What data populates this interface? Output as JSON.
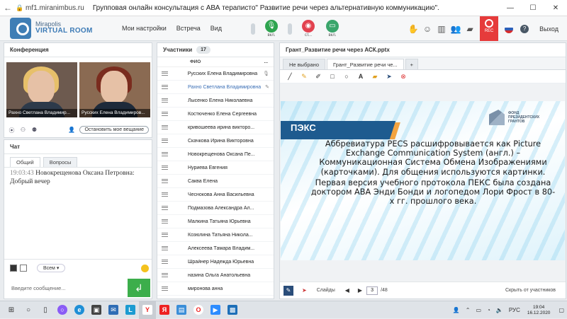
{
  "browser": {
    "back_icon": "back-arrow-icon",
    "url": "mf1.miranimbus.ru",
    "title": "Групповая онлайн консультация с АВА тераписто\" Развитие речи через альтернативную коммуникацию\".",
    "window_controls": [
      "—",
      "☐",
      "✕"
    ]
  },
  "app": {
    "logo_line1": "Mirapolis",
    "logo_line2": "VIRTUAL ROOM",
    "menu": [
      "Мои настройки",
      "Встреча",
      "Вид"
    ],
    "controls": [
      {
        "label": "вкл.",
        "icon": "microphone-icon",
        "color": "#2ea44f"
      },
      {
        "label": "ст...",
        "icon": "camera-icon",
        "color": "#e2424f"
      },
      {
        "label": "вкл.",
        "icon": "screen-share-icon",
        "color": "#3aa56b"
      }
    ],
    "rec_label": "REC",
    "exit_label": "Выход"
  },
  "conference": {
    "title": "Конференция",
    "videos": [
      {
        "name": "Рахно Светлана  Владимир..."
      },
      {
        "name": "Русских Елена Владимиров..."
      }
    ],
    "stop_button": "Остановить мое вещание"
  },
  "chat": {
    "title": "Чат",
    "tabs": [
      "Общий",
      "Вопросы"
    ],
    "messages": [
      {
        "time": "19:03:43",
        "author": "Новокрещенова  Оксана Петровна:",
        "text": "Добрый вечер"
      }
    ],
    "recipient": "Всем",
    "input_placeholder": "Введите сообщение...",
    "send_icon": "send-icon"
  },
  "participants": {
    "title": "Участники",
    "count": "17",
    "column": "ФИО",
    "menu": "...",
    "rows": [
      {
        "name": "Русских Елена Владимировна",
        "highlight": false,
        "icon": "microphone-icon"
      },
      {
        "name": "Рахно Светлана  Владимировна",
        "highlight": true,
        "icon": "presenter-icon"
      },
      {
        "name": "Лысенко Елена  Николаевна",
        "highlight": false
      },
      {
        "name": "Костюченко  Елена Сергеевна",
        "highlight": false
      },
      {
        "name": "кривошеева  ирина викторо...",
        "highlight": false
      },
      {
        "name": "Скачкова  Ирина Викторовна",
        "highlight": false
      },
      {
        "name": "Новокрещенова  Оксана Пе...",
        "highlight": false
      },
      {
        "name": "Нуриева Евгения",
        "highlight": false
      },
      {
        "name": "Саква  Елена",
        "highlight": false
      },
      {
        "name": "Чеснокова  Анна  Васильевна",
        "highlight": false
      },
      {
        "name": "Подмазова  Александра Ал...",
        "highlight": false
      },
      {
        "name": "Малкина Татьяна  Юрьевна",
        "highlight": false
      },
      {
        "name": "Козюлина  Татьяна Никола...",
        "highlight": false
      },
      {
        "name": "Алексеева  Тамара  Владим...",
        "highlight": false
      },
      {
        "name": "Шрайнер Надежда Юрьевна",
        "highlight": false
      },
      {
        "name": "назина  Ольга Анатольевна",
        "highlight": false
      },
      {
        "name": "миронова  анна",
        "highlight": false
      }
    ]
  },
  "board": {
    "title": "Грант_Развитие речи через АСК.pptx",
    "tabs": [
      "Не выбрано",
      "Грант_Развитие речи че..."
    ],
    "add_tab": "+",
    "slide": {
      "ribbon": "ПЭКС",
      "fund_text": "ФОНД ПРЕЗИДЕНТСКИХ ГРАНТОВ",
      "para1": "Аббревиатура PECS расшифровывается как Picture Exchange Communication System (англ.) – Коммуникационная Система Обмена Изображениями (карточками). Для общения используются картинки.",
      "para2": "Первая версия учебного протокола ПЕКС была создана доктором АВА Энди Бонди и логопедом Лори Фрост в 80-х гг. прошлого века."
    },
    "footer": {
      "slides_label": "Слайды",
      "current_page": "3",
      "total_pages": "/48",
      "hide_participants": "Скрыть от участников"
    }
  },
  "taskbar": {
    "lang": "РУС",
    "time": "19:04",
    "date": "16.12.2020"
  }
}
